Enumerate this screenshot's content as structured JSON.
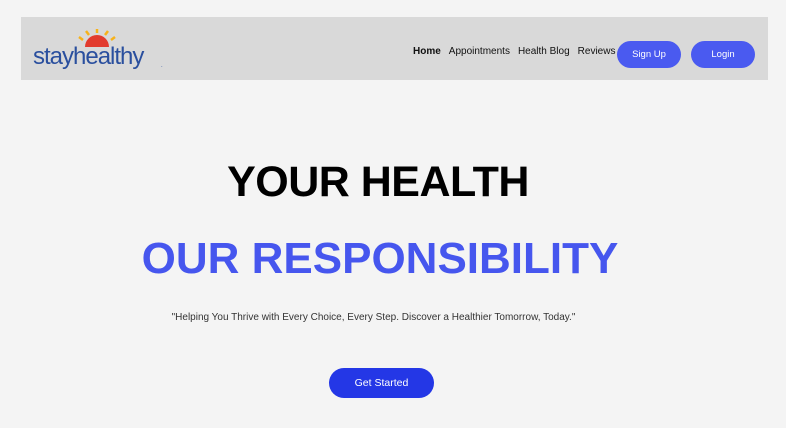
{
  "brand": {
    "logo_text_1": "stay",
    "logo_text_2": "healthy",
    "logo_mark": "."
  },
  "nav": {
    "links": [
      {
        "label": "Home",
        "active": true
      },
      {
        "label": "Appointments",
        "active": false
      },
      {
        "label": "Health Blog",
        "active": false
      },
      {
        "label": "Reviews",
        "active": false
      }
    ],
    "signup_label": "Sign Up",
    "login_label": "Login"
  },
  "hero": {
    "line1": "YOUR HEALTH",
    "line2": "OUR RESPONSIBILITY",
    "tagline": "\"Helping You Thrive with Every Choice, Every Step. Discover a Healthier Tomorrow, Today.\"",
    "cta_label": "Get Started"
  },
  "colors": {
    "page_bg": "#f4f4f4",
    "navbar_bg": "#d9d9d9",
    "accent": "#4656ee",
    "cta": "#2437e6",
    "logo_blue": "#2a4f9e",
    "sun_red": "#e23b2e",
    "sun_yellow": "#f7b21a"
  },
  "icons": {
    "logo_sun": "sun-rays-icon"
  }
}
